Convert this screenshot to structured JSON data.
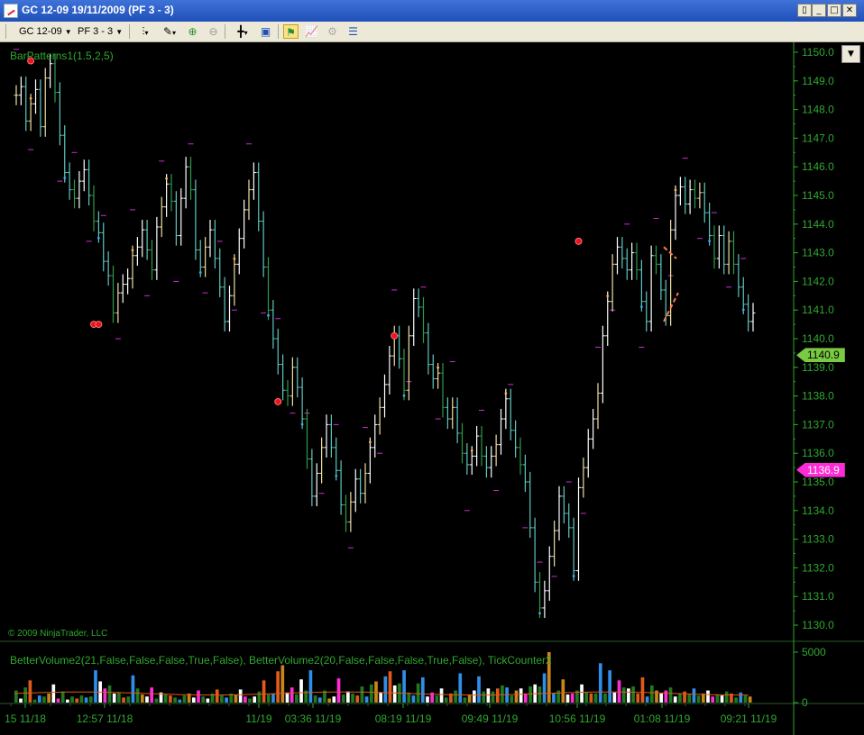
{
  "window": {
    "title": "GC 12-09  19/11/2009 (PF 3 - 3)"
  },
  "toolbar": {
    "instrument": "GC 12-09",
    "period": "PF 3 - 3"
  },
  "indicators": {
    "price_panel_label": "BarPatterns1(1.5,2,5)",
    "copyright": "© 2009 NinjaTrader, LLC",
    "volume_panel_label": "BetterVolume2(21,False,False,False,True,False),  BetterVolume2(20,False,False,False,True,False),  TickCounter2"
  },
  "colors": {
    "background": "#000000",
    "axis": "#2fa82f",
    "last_price_tag": "#7ac943",
    "marker_tag": "#ff2bd6",
    "up_bar": "#f5deb3",
    "down_bar": "#4fc3c3"
  },
  "chart_data": [
    {
      "type": "line",
      "panel": "price",
      "y_ticks": [
        "1150.0",
        "1149.0",
        "1148.0",
        "1147.0",
        "1146.0",
        "1145.0",
        "1144.0",
        "1143.0",
        "1142.0",
        "1141.0",
        "1140.0",
        "1139.0",
        "1138.0",
        "1137.0",
        "1136.0",
        "1135.0",
        "1134.0",
        "1133.0",
        "1132.0",
        "1131.0",
        "1130.0"
      ],
      "ylim": [
        1129.5,
        1150.1
      ],
      "last_price": {
        "label": "1140.9",
        "value": 1140.9
      },
      "marker_price": {
        "label": "1136.9",
        "value": 1136.9
      },
      "x_ticks": [
        "15 11/18",
        "12:57 11/18",
        "11/19",
        "03:36 11/19",
        "08:19 11/19",
        "09:49 11/19",
        "10:56 11/19",
        "01:08 11/19",
        "09:21 11/19"
      ],
      "series": [
        {
          "values": [
            1148.5,
            1148.8,
            1147.6,
            1148.2,
            1148.7,
            1147.4,
            1149.1,
            1149.6,
            1148.6,
            1147.1,
            1145.8,
            1145.2,
            1144.9,
            1145.5,
            1145.9,
            1145.0,
            1144.1,
            1143.7,
            1142.7,
            1142.2,
            1140.9,
            1141.6,
            1141.9,
            1142.1,
            1142.9,
            1143.2,
            1143.8,
            1143.1,
            1142.4,
            1143.9,
            1144.6,
            1145.4,
            1144.8,
            1143.6,
            1144.9,
            1146.0,
            1145.2,
            1143.1,
            1142.5,
            1143.2,
            1143.8,
            1142.8,
            1141.8,
            1140.6,
            1141.5,
            1142.6,
            1143.5,
            1144.5,
            1145.2,
            1145.8,
            1144.1,
            1142.5,
            1141.0,
            1140.0,
            1139.1,
            1138.2,
            1138.0,
            1139.0,
            1138.3,
            1137.2,
            1135.8,
            1134.5,
            1135.3,
            1136.2,
            1137.0,
            1136.2,
            1135.4,
            1134.2,
            1133.6,
            1134.3,
            1135.1,
            1134.6,
            1135.3,
            1136.2,
            1137.0,
            1137.6,
            1138.4,
            1139.4,
            1140.1,
            1139.3,
            1138.2,
            1140.1,
            1141.4,
            1141.1,
            1140.2,
            1139.1,
            1138.6,
            1138.8,
            1137.6,
            1137.2,
            1137.6,
            1136.7,
            1136.0,
            1135.6,
            1135.9,
            1136.6,
            1135.9,
            1135.5,
            1135.9,
            1136.3,
            1137.2,
            1137.9,
            1136.8,
            1136.2,
            1135.6,
            1135.0,
            1133.4,
            1131.5,
            1130.6,
            1131.2,
            1132.4,
            1133.3,
            1134.5,
            1133.9,
            1133.4,
            1131.9,
            1134.8,
            1135.5,
            1136.5,
            1137.2,
            1138.1,
            1140.1,
            1141.3,
            1142.6,
            1143.2,
            1142.8,
            1142.4,
            1143.0,
            1142.4,
            1141.3,
            1140.6,
            1142.9,
            1142.6,
            1141.7,
            1140.8,
            1143.8,
            1145.0,
            1145.3,
            1144.7,
            1145.2,
            1144.9,
            1145.1,
            1144.4,
            1143.6,
            1142.8,
            1143.6,
            1142.6,
            1143.4,
            1142.6,
            1141.8,
            1141.2,
            1140.6,
            1140.9
          ]
        }
      ],
      "annotations": [
        "red reversal dots",
        "magenta dash levels",
        "orange dashed pattern lines",
        "small colored pattern dots"
      ]
    },
    {
      "type": "bar",
      "panel": "volume",
      "y_ticks": [
        "5000",
        "0"
      ],
      "ylim": [
        0,
        5000
      ],
      "series": [
        {
          "values": [
            1200,
            400,
            1500,
            2200,
            300,
            700,
            600,
            900,
            1800,
            400,
            1100,
            300,
            600,
            400,
            700,
            500,
            600,
            3200,
            2100,
            1400,
            1700,
            900,
            1000,
            500,
            600,
            2700,
            1400,
            800,
            600,
            1500,
            400,
            1000,
            800,
            700,
            500,
            300,
            700,
            900,
            500,
            1200,
            600,
            400,
            900,
            1300,
            700,
            500,
            900,
            800,
            1300,
            600,
            400,
            600,
            1100,
            2200,
            800,
            900,
            3100,
            3700,
            1000,
            1500,
            800,
            2300,
            1200,
            3200,
            700,
            500,
            1200,
            400,
            600,
            2400,
            800,
            1100,
            900,
            700,
            1600,
            600,
            1800,
            2100,
            1000,
            2600,
            3100,
            1700,
            1900,
            3200,
            1000,
            700,
            1900,
            2500,
            600,
            1000,
            700,
            1400,
            500,
            900,
            1200,
            2900,
            500,
            800,
            1200,
            2600,
            1100,
            1400,
            1100,
            1400,
            1700,
            1500,
            700,
            1200,
            1400,
            900,
            1600,
            1800,
            1600,
            2900,
            5000,
            900,
            1200,
            2300,
            800,
            900,
            1200,
            1800,
            1000,
            900,
            900,
            3900,
            900,
            3200,
            1000,
            2200,
            1500,
            1400,
            1600,
            900,
            2500,
            600,
            1700,
            1200,
            900,
            1200,
            1500,
            600,
            900,
            1100,
            800,
            1400,
            700,
            900,
            1200,
            600,
            800,
            700,
            1100,
            900,
            500,
            1000,
            700,
            600
          ]
        }
      ]
    }
  ]
}
